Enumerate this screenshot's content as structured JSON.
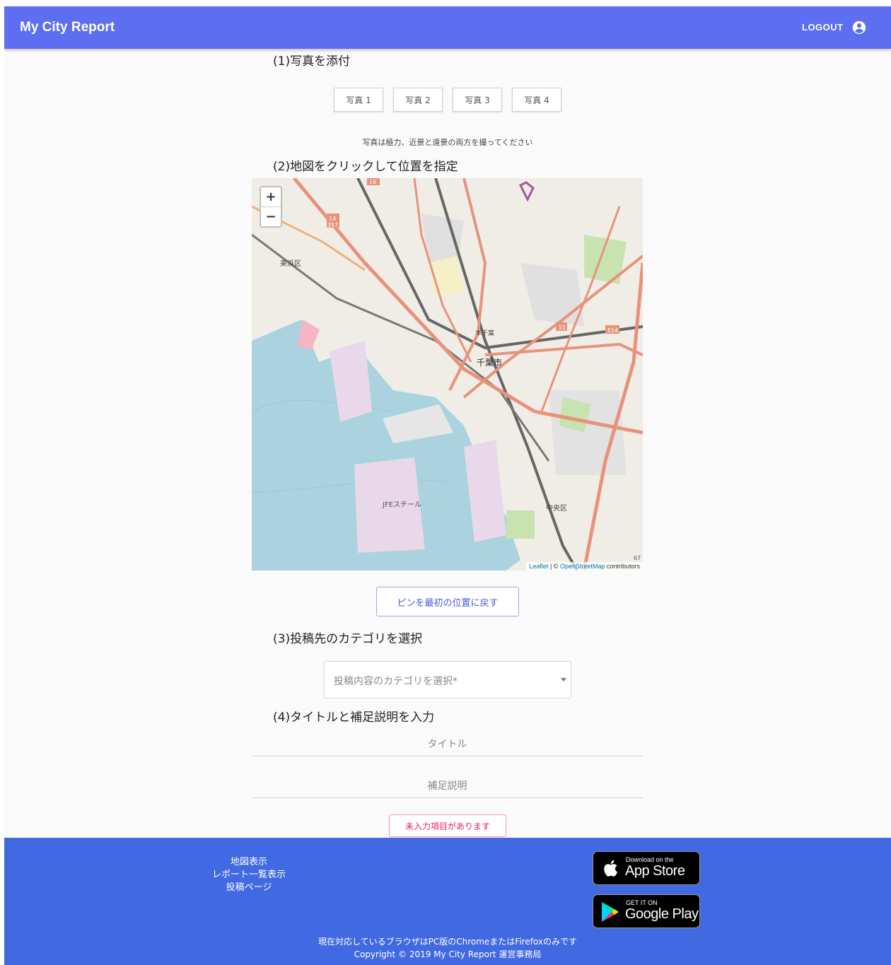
{
  "appbar": {
    "title": "My City Report",
    "logout_label": "LOGOUT",
    "account_icon": "account-circle-icon"
  },
  "step1": {
    "heading": "(1)写真を添付",
    "photo_buttons": [
      "写真 1",
      "写真 2",
      "写真 3",
      "写真 4"
    ],
    "note": "写真は極力、近景と遠景の両方を撮ってください"
  },
  "step2": {
    "heading": "(2)地図をクリックして位置を指定",
    "map": {
      "zoom_in": "+",
      "zoom_out": "−",
      "attribution_leaflet": "Leaflet",
      "attribution_sep": " | © ",
      "attribution_osm": "OpenStreetMap",
      "attribution_tail": " contributors",
      "labels": [
        "千葉市",
        "JFEスチール",
        "中央区",
        "美浜区",
        "本千葉",
        "E14",
        "14",
        "357",
        "51",
        "16",
        "67"
      ]
    },
    "reset_pin_label": "ピンを最初の位置に戻す"
  },
  "step3": {
    "heading": "(3)投稿先のカテゴリを選択",
    "category_placeholder": "投稿内容のカテゴリを選択*"
  },
  "step4": {
    "heading": "(4)タイトルと補足説明を入力",
    "title_placeholder": "タイトル",
    "description_placeholder": "補足説明",
    "warning_label": "未入力項目があります"
  },
  "footer": {
    "links": [
      "地図表示",
      "レポート一覧表示",
      "投稿ページ"
    ],
    "app_store": {
      "small": "Download on the",
      "big": "App Store"
    },
    "google_play": {
      "small": "GET IT ON",
      "big": "Google Play"
    },
    "browser_note": "現在対応しているブラウザはPC版のChromeまたはFirefoxのみです",
    "copyright": "Copyright © 2019 My City Report 運営事務局"
  },
  "colors": {
    "appbar": "#5e6ef0",
    "footer": "#4169e1",
    "primary_text": "#4a5ae0",
    "warning": "#e91e63",
    "background": "#fafafa"
  }
}
